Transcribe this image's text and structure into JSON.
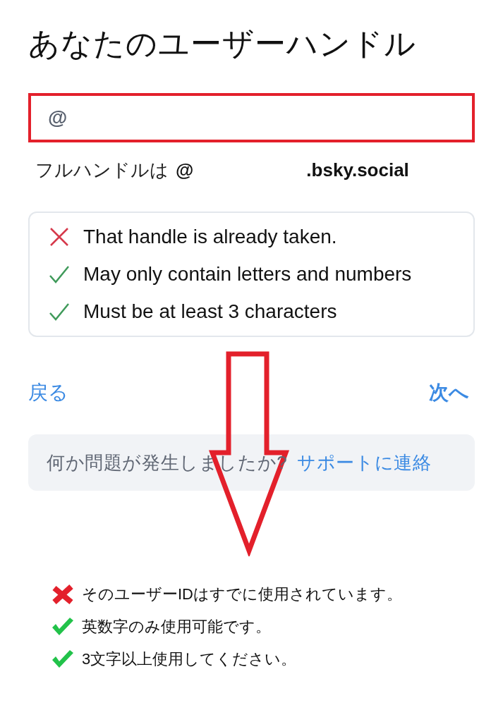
{
  "title": "あなたのユーザーハンドル",
  "handle_field": {
    "prefix": "@",
    "highlighted": true
  },
  "full_handle": {
    "label": "フルハンドルは",
    "at": "@",
    "suffix": ".bsky.social"
  },
  "rules": [
    {
      "text": "That handle is already taken.",
      "passed": false
    },
    {
      "text": "May only contain letters and numbers",
      "passed": true
    },
    {
      "text": "Must be at least 3 characters",
      "passed": true
    }
  ],
  "back_button": "戻る",
  "next_button": "次へ",
  "support": {
    "question": "何か問題が発生しましたか?",
    "link": "サポートに連絡"
  },
  "notes": [
    {
      "text": "そのユーザーIDはすでに使用されています。",
      "passed": false
    },
    {
      "text": "英数字のみ使用可能です。",
      "passed": true
    },
    {
      "text": "3文字以上使用してください。",
      "passed": true
    }
  ]
}
